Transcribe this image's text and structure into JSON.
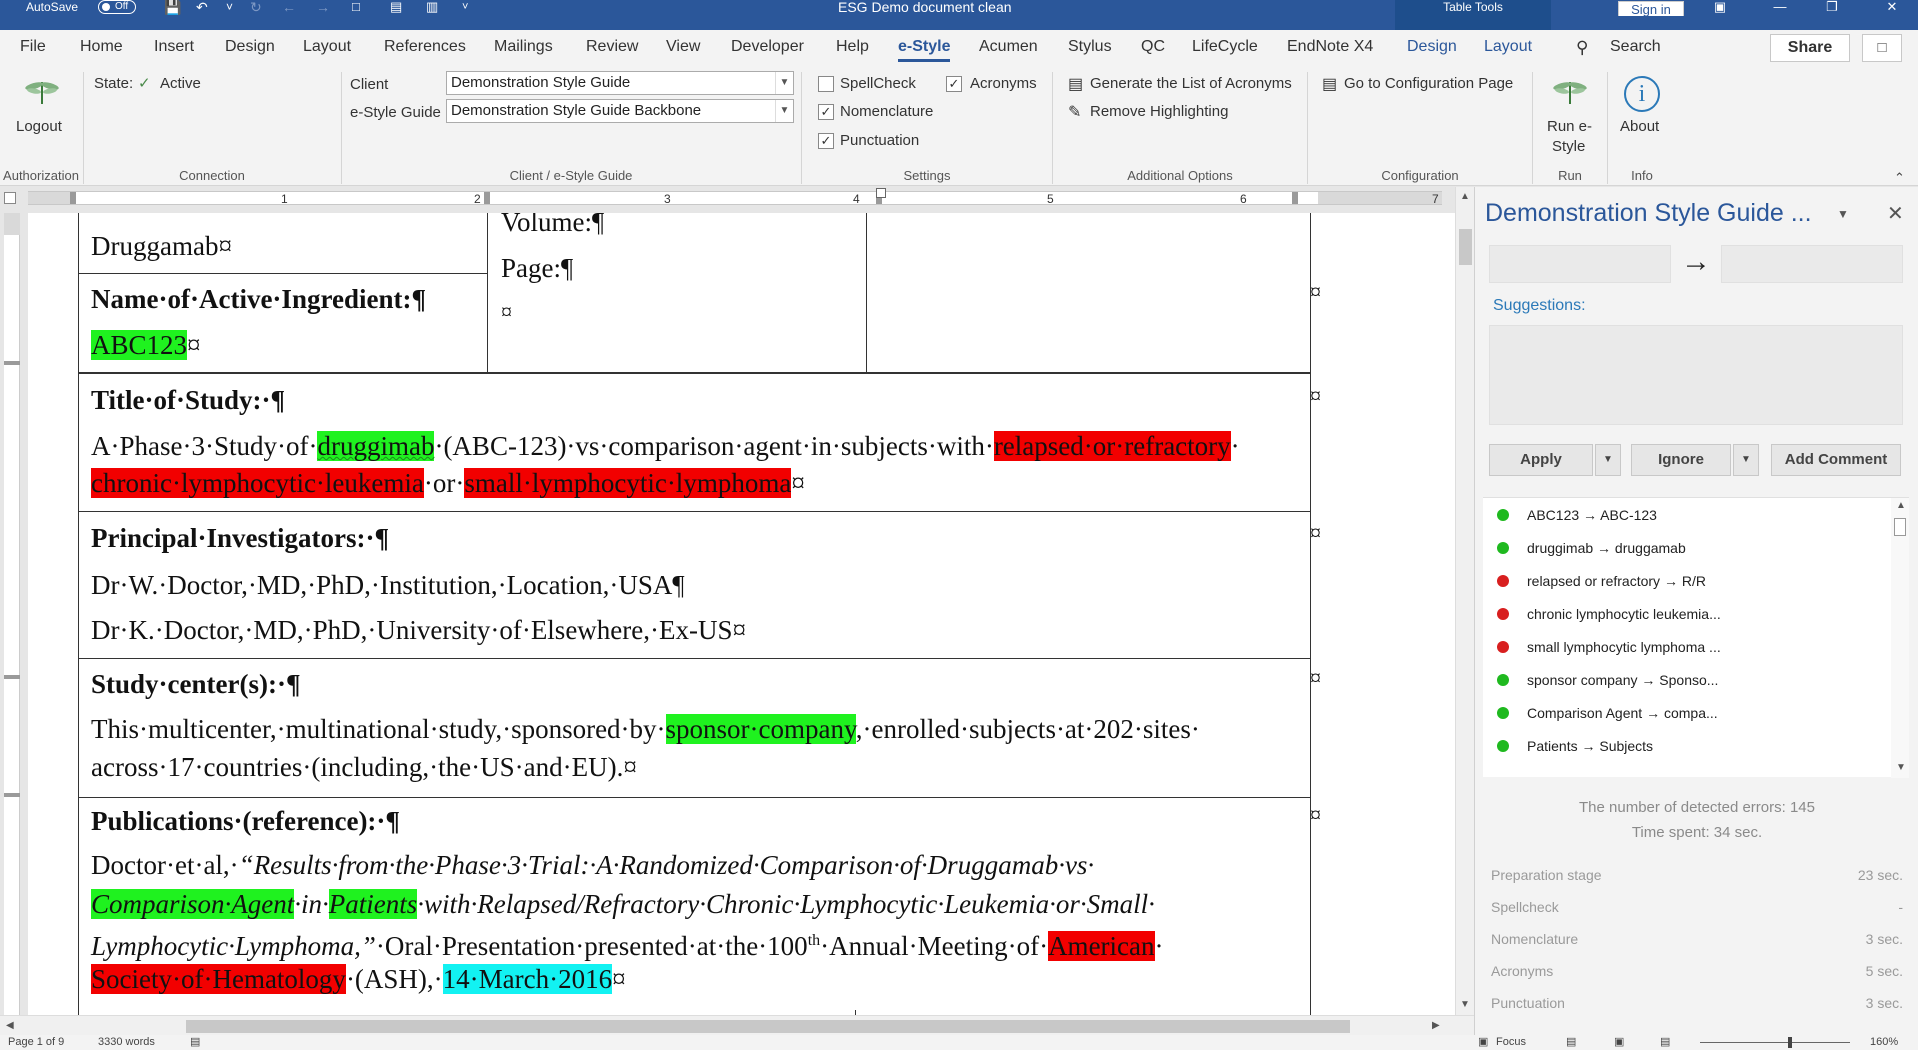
{
  "titlebar": {
    "autosave_label": "AutoSave",
    "autosave_state": "Off",
    "doc_title": "ESG Demo document clean",
    "table_tools": "Table Tools",
    "signin": "Sign in"
  },
  "tabs": [
    "File",
    "Home",
    "Insert",
    "Design",
    "Layout",
    "References",
    "Mailings",
    "Review",
    "View",
    "Developer",
    "Help",
    "e-Style",
    "Acumen",
    "Stylus",
    "QC",
    "LifeCycle",
    "EndNote X4",
    "Design",
    "Layout"
  ],
  "tabs_search": "Search",
  "share_label": "Share",
  "ribbon": {
    "logout": "Logout",
    "state_label": "State:",
    "state_value": "Active",
    "client_label": "Client",
    "client_value": "Demonstration Style Guide",
    "estyle_label": "e-Style Guide",
    "estyle_value": "Demonstration Style Guide Backbone",
    "spellcheck": "SpellCheck",
    "acronyms": "Acronyms",
    "nomenclature": "Nomenclature",
    "punctuation": "Punctuation",
    "generate_list": "Generate the List of Acronyms",
    "remove_highlighting": "Remove Highlighting",
    "go_config": "Go to Configuration Page",
    "run_estyle_1": "Run e-",
    "run_estyle_2": "Style",
    "about": "About",
    "groups": {
      "authorization": "Authorization",
      "connection": "Connection",
      "client_guide": "Client / e-Style Guide",
      "settings": "Settings",
      "additional": "Additional Options",
      "configuration": "Configuration",
      "run": "Run",
      "info": "Info"
    }
  },
  "ruler": [
    "1",
    "2",
    "3",
    "4",
    "5",
    "6",
    "7"
  ],
  "document": {
    "cell1_line1": "Druggamab¤",
    "cell2_heading": "Name·of·Active·Ingredient:¶",
    "cell2_value": "ABC123",
    "cell2_end": "¤",
    "cell3_volume": "Volume:¶",
    "cell3_page": "Page:¶",
    "cell3_end": "¤",
    "title_heading": "Title·of·Study:·¶",
    "title_l1_a": "A·Phase·3·Study·of·",
    "title_l1_b": "druggimab",
    "title_l1_c": "·(ABC-123)·vs·comparison·agent·in·subjects·with·",
    "title_l1_d": "relapsed·or·refractory",
    "title_l1_e": "·",
    "title_l2_a": "chronic·lymphocytic·leukemia",
    "title_l2_b": "·or·",
    "title_l2_c": "small·lymphocytic·lymphoma",
    "title_l2_d": "¤",
    "pi_heading": "Principal·Investigators:·¶",
    "pi_l1": "Dr·W.·Doctor,·MD,·PhD,·Institution,·Location,·USA¶",
    "pi_l2": "Dr·K.·Doctor,·MD,·PhD,·University·of·Elsewhere,·Ex-US¤",
    "sc_heading": "Study·center(s):·¶",
    "sc_l1_a": "This·multicenter,·multinational·study,·sponsored·by·",
    "sc_l1_b": "sponsor·company",
    "sc_l1_c": ",·enrolled·subjects·at·202·sites·",
    "sc_l2": "across·17·countries·(including,·the·US·and·EU).¤",
    "pub_heading": "Publications·(reference):·¶",
    "pub_l1_a": "Doctor·et·al,·",
    "pub_l1_b": "“Results·from·the·Phase·3·Trial:·A·Randomized·Comparison·of·Druggamab·vs·",
    "pub_l2_a": "Comparison·Agent",
    "pub_l2_b": "·in·",
    "pub_l2_c": "Patients",
    "pub_l2_d": "·with·Relapsed/Refractory·Chronic·Lymphocytic·Leukemia·or·Small·",
    "pub_l3_a": "Lymphocytic·Lymphoma,”",
    "pub_l3_b": "·Oral·Presentation·presented·at·the·100",
    "pub_l3_sup": "th",
    "pub_l3_c": "·Annual·Meeting·of·",
    "pub_l3_d": "American",
    "pub_l3_e": "·",
    "pub_l4_a": "Society·of·Hematology",
    "pub_l4_b": "·(ASH),·",
    "pub_l4_c": "14·March·2016",
    "pub_l4_d": "¤",
    "row_mark": "¤"
  },
  "pane": {
    "title": "Demonstration Style Guide ...",
    "arrow": "→",
    "suggestions_label": "Suggestions:",
    "apply": "Apply",
    "ignore": "Ignore",
    "add_comment": "Add Comment",
    "errors": [
      {
        "text": "ABC123 → ABC-123",
        "color": "#1fb91f"
      },
      {
        "text": "druggimab → druggamab",
        "color": "#1fb91f"
      },
      {
        "text": "relapsed or refractory → R/R",
        "color": "#d81f1f"
      },
      {
        "text": "chronic lymphocytic leukemia...",
        "color": "#d81f1f"
      },
      {
        "text": "small lymphocytic lymphoma ...",
        "color": "#d81f1f"
      },
      {
        "text": "sponsor company → Sponso...",
        "color": "#1fb91f"
      },
      {
        "text": "Comparison Agent → compa...",
        "color": "#1fb91f"
      },
      {
        "text": "Patients → Subjects",
        "color": "#1fb91f"
      }
    ],
    "detected_errors": "The number of detected errors: 145",
    "time_spent": "Time spent: 34 sec.",
    "stats": [
      {
        "label": "Preparation stage",
        "value": "23 sec."
      },
      {
        "label": "Spellcheck",
        "value": "-"
      },
      {
        "label": "Nomenclature",
        "value": "3 sec."
      },
      {
        "label": "Acronyms",
        "value": "5 sec."
      },
      {
        "label": "Punctuation",
        "value": "3 sec."
      }
    ]
  },
  "statusbar": {
    "page": "Page 1 of 9",
    "words": "3330 words",
    "focus": "Focus",
    "zoom": "160%"
  }
}
